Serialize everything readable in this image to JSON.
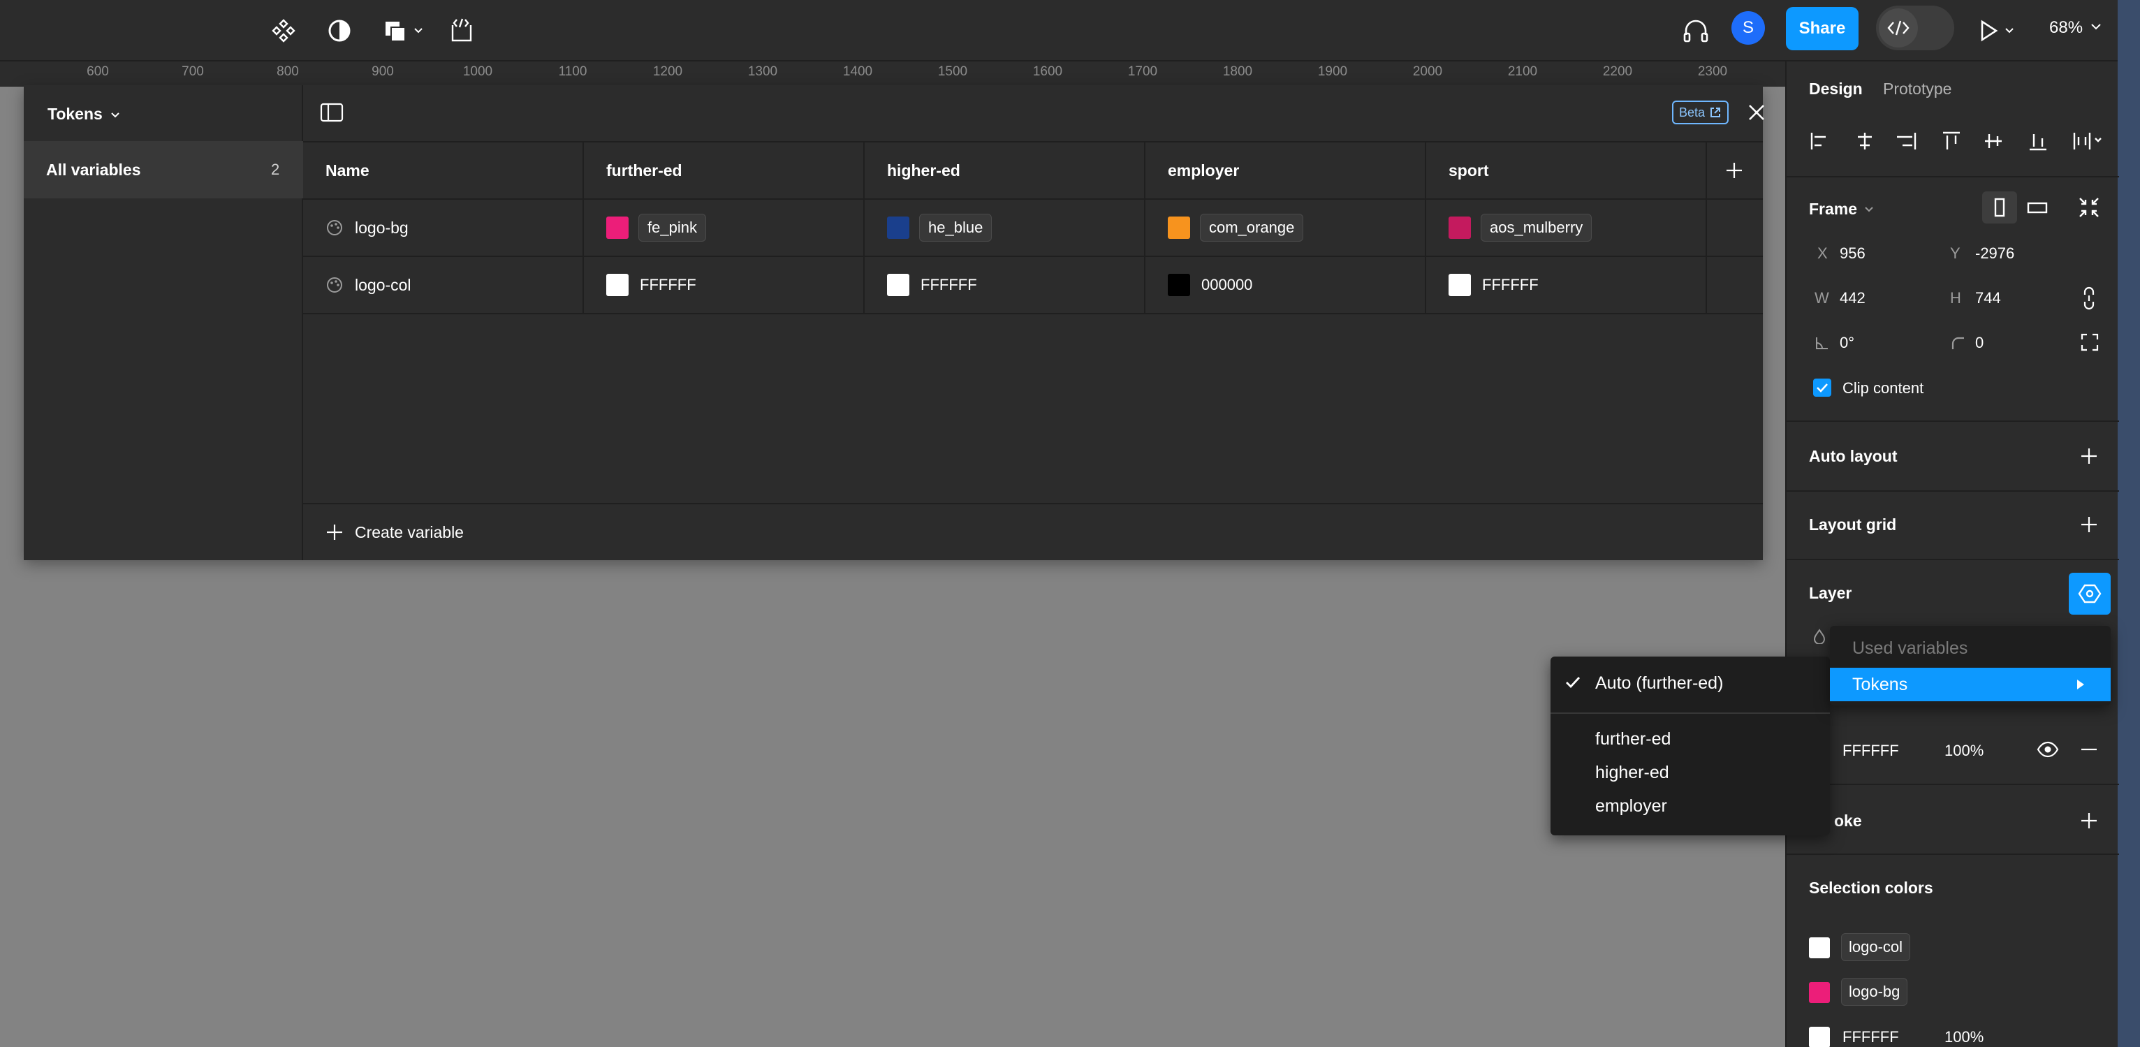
{
  "toolbar": {
    "share_label": "Share",
    "avatar_initial": "S",
    "zoom": "68%"
  },
  "ruler": {
    "ticks": [
      "600",
      "700",
      "800",
      "900",
      "1000",
      "1100",
      "1200",
      "1300",
      "1400",
      "1500",
      "1600",
      "1700",
      "1800",
      "1900",
      "2000",
      "2100",
      "2200",
      "2300"
    ]
  },
  "variables": {
    "collection": "Tokens",
    "beta_label": "Beta",
    "all_variables_label": "All variables",
    "all_variables_count": "2",
    "columns": [
      "Name",
      "further-ed",
      "higher-ed",
      "employer",
      "sport"
    ],
    "rows": [
      {
        "name": "logo-bg",
        "values": [
          {
            "label": "fe_pink",
            "color": "#ec1e79",
            "type": "alias"
          },
          {
            "label": "he_blue",
            "color": "#1a3f8c",
            "type": "alias"
          },
          {
            "label": "com_orange",
            "color": "#f7931e",
            "type": "alias"
          },
          {
            "label": "aos_mulberry",
            "color": "#c41a5e",
            "type": "alias"
          }
        ]
      },
      {
        "name": "logo-col",
        "values": [
          {
            "label": "FFFFFF",
            "color": "#ffffff",
            "type": "hex"
          },
          {
            "label": "FFFFFF",
            "color": "#ffffff",
            "type": "hex"
          },
          {
            "label": "000000",
            "color": "#000000",
            "type": "hex"
          },
          {
            "label": "FFFFFF",
            "color": "#ffffff",
            "type": "hex"
          }
        ]
      }
    ],
    "create_label": "Create variable"
  },
  "design_panel": {
    "tab_design": "Design",
    "tab_prototype": "Prototype",
    "frame_label": "Frame",
    "x_label": "X",
    "x_value": "956",
    "y_label": "Y",
    "y_value": "-2976",
    "w_label": "W",
    "w_value": "442",
    "h_label": "H",
    "h_value": "744",
    "rotation": "0°",
    "radius": "0",
    "clip_content": "Clip content",
    "auto_layout": "Auto layout",
    "layout_grid": "Layout grid",
    "layer": "Layer",
    "fill_hex": "FFFFFF",
    "fill_opacity": "100%",
    "stroke_partial": "oke",
    "selection_colors": "Selection colors",
    "selection": [
      {
        "label": "logo-col",
        "color": "#ffffff",
        "type": "chip"
      },
      {
        "label": "logo-bg",
        "color": "#ec1e79",
        "type": "chip"
      },
      {
        "label": "FFFFFF",
        "color": "#ffffff",
        "type": "hex",
        "opacity": "100%"
      }
    ]
  },
  "mode_menu": {
    "selected": "Auto (further-ed)",
    "options": [
      "further-ed",
      "higher-ed",
      "employer"
    ]
  },
  "variable_menu": {
    "header": "Used variables",
    "active_item": "Tokens"
  },
  "accent": "#0d99ff"
}
